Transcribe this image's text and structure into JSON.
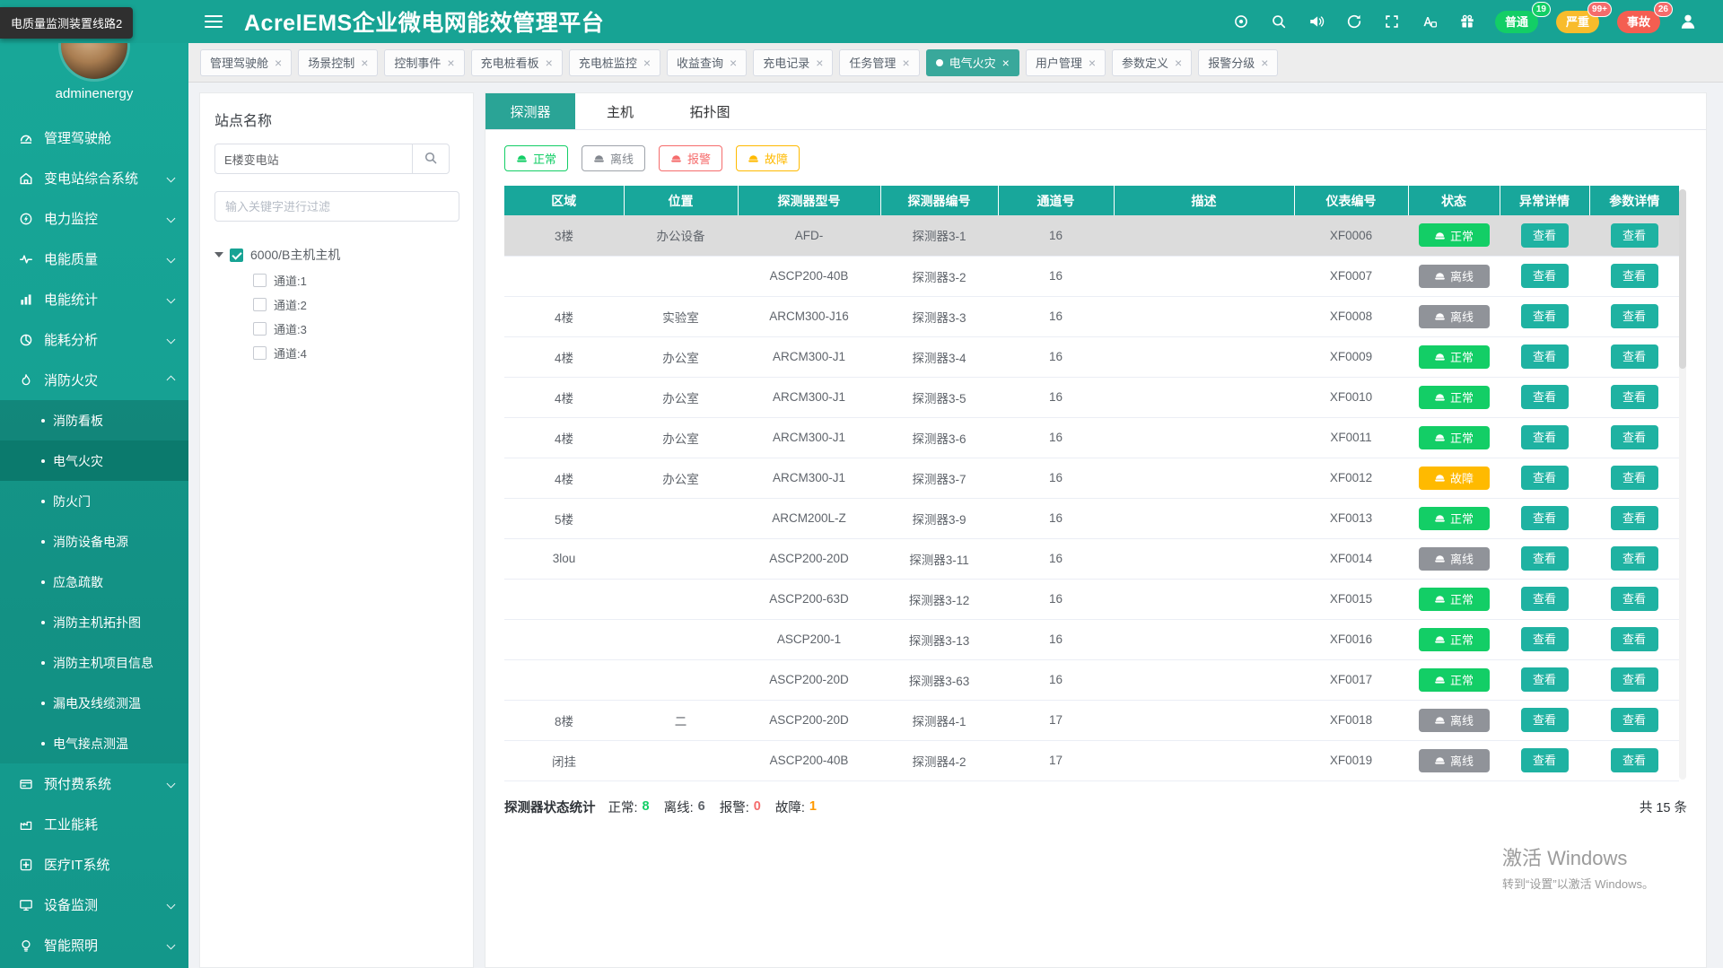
{
  "colors": {
    "primary": "#17a394",
    "green": "#13ce66",
    "gray": "#909399",
    "red": "#f56c6c",
    "orange": "#ffba00",
    "tab_active": "#39a89b"
  },
  "tooltip": {
    "text": "电质量监测装置线路2"
  },
  "header": {
    "title": "AcrelEMS企业微电网能效管理平台",
    "icons": [
      "target",
      "search",
      "speaker",
      "refresh",
      "fullscreen",
      "translate",
      "gift"
    ],
    "pills": [
      {
        "key": "normal",
        "label": "普通",
        "count": "19",
        "color": "#13ce66",
        "badge_color": "#13ce66"
      },
      {
        "key": "severe",
        "label": "严重",
        "count": "99+",
        "color": "#f8bc2c",
        "badge_color": "#f56c6c"
      },
      {
        "key": "accident",
        "label": "事故",
        "count": "26",
        "color": "#f45e51",
        "badge_color": "#f56c6c"
      }
    ]
  },
  "sidebar": {
    "username": "adminenergy",
    "items": [
      {
        "label": "管理驾驶舱",
        "icon": "dashboard",
        "expandable": false
      },
      {
        "label": "变电站综合系统",
        "icon": "station",
        "expandable": true
      },
      {
        "label": "电力监控",
        "icon": "power",
        "expandable": true
      },
      {
        "label": "电能质量",
        "icon": "quality",
        "expandable": true
      },
      {
        "label": "电能统计",
        "icon": "stats",
        "expandable": true
      },
      {
        "label": "能耗分析",
        "icon": "analysis",
        "expandable": true
      },
      {
        "label": "消防火灾",
        "icon": "fire",
        "expandable": true,
        "expanded": true,
        "children": [
          {
            "label": "消防看板",
            "highlighted": true
          },
          {
            "label": "电气火灾",
            "active": true
          },
          {
            "label": "防火门"
          },
          {
            "label": "消防设备电源"
          },
          {
            "label": "应急疏散"
          },
          {
            "label": "消防主机拓扑图"
          },
          {
            "label": "消防主机项目信息"
          },
          {
            "label": "漏电及线缆测温"
          },
          {
            "label": "电气接点测温"
          }
        ]
      },
      {
        "label": "预付费系统",
        "icon": "prepay",
        "expandable": true
      },
      {
        "label": "工业能耗",
        "icon": "industry",
        "expandable": false
      },
      {
        "label": "医疗IT系统",
        "icon": "medical",
        "expandable": false
      },
      {
        "label": "设备监测",
        "icon": "device",
        "expandable": true
      },
      {
        "label": "智能照明",
        "icon": "light",
        "expandable": true
      }
    ]
  },
  "tabbar": {
    "tabs": [
      {
        "label": "管理驾驶舱"
      },
      {
        "label": "场景控制"
      },
      {
        "label": "控制事件"
      },
      {
        "label": "充电桩看板"
      },
      {
        "label": "充电桩监控"
      },
      {
        "label": "收益查询"
      },
      {
        "label": "充电记录"
      },
      {
        "label": "任务管理"
      },
      {
        "label": "电气火灾",
        "active": true
      },
      {
        "label": "用户管理"
      },
      {
        "label": "参数定义"
      },
      {
        "label": "报警分级"
      }
    ]
  },
  "site_panel": {
    "title": "站点名称",
    "search_value": "E楼变电站",
    "filter_placeholder": "输入关键字进行过滤",
    "tree": {
      "root": {
        "label": "6000/B主机主机",
        "checked": true
      },
      "children": [
        {
          "label": "通道:1"
        },
        {
          "label": "通道:2"
        },
        {
          "label": "通道:3"
        },
        {
          "label": "通道:4"
        }
      ]
    }
  },
  "main": {
    "tabs": [
      {
        "label": "探测器",
        "active": true
      },
      {
        "label": "主机"
      },
      {
        "label": "拓扑图"
      }
    ],
    "filters": [
      {
        "label": "正常",
        "type": "normal"
      },
      {
        "label": "离线",
        "type": "offline"
      },
      {
        "label": "报警",
        "type": "alarm"
      },
      {
        "label": "故障",
        "type": "fault"
      }
    ],
    "table": {
      "headers": [
        "区域",
        "位置",
        "探测器型号",
        "探测器编号",
        "通道号",
        "描述",
        "仪表编号",
        "状态",
        "异常详情",
        "参数详情"
      ],
      "view_label": "查看",
      "status_labels": {
        "normal": "正常",
        "offline": "离线",
        "alarm": "报警",
        "fault": "故障"
      },
      "rows": [
        {
          "area": "3楼",
          "location": "办公设备",
          "model": "AFD-",
          "detector": "探测器3-1",
          "channel": "16",
          "desc": "",
          "meter": "XF0006",
          "status": "normal",
          "selected": true
        },
        {
          "area": "",
          "location": "",
          "model": "ASCP200-40B",
          "detector": "探测器3-2",
          "channel": "16",
          "desc": "",
          "meter": "XF0007",
          "status": "offline"
        },
        {
          "area": "4楼",
          "location": "实验室",
          "model": "ARCM300-J16",
          "detector": "探测器3-3",
          "channel": "16",
          "desc": "",
          "meter": "XF0008",
          "status": "offline"
        },
        {
          "area": "4楼",
          "location": "办公室",
          "model": "ARCM300-J1",
          "detector": "探测器3-4",
          "channel": "16",
          "desc": "",
          "meter": "XF0009",
          "status": "normal"
        },
        {
          "area": "4楼",
          "location": "办公室",
          "model": "ARCM300-J1",
          "detector": "探测器3-5",
          "channel": "16",
          "desc": "",
          "meter": "XF0010",
          "status": "normal"
        },
        {
          "area": "4楼",
          "location": "办公室",
          "model": "ARCM300-J1",
          "detector": "探测器3-6",
          "channel": "16",
          "desc": "",
          "meter": "XF0011",
          "status": "normal"
        },
        {
          "area": "4楼",
          "location": "办公室",
          "model": "ARCM300-J1",
          "detector": "探测器3-7",
          "channel": "16",
          "desc": "",
          "meter": "XF0012",
          "status": "fault"
        },
        {
          "area": "5楼",
          "location": "",
          "model": "ARCM200L-Z",
          "detector": "探测器3-9",
          "channel": "16",
          "desc": "",
          "meter": "XF0013",
          "status": "normal"
        },
        {
          "area": "3lou",
          "location": "",
          "model": "ASCP200-20D",
          "detector": "探测器3-11",
          "channel": "16",
          "desc": "",
          "meter": "XF0014",
          "status": "offline"
        },
        {
          "area": "",
          "location": "",
          "model": "ASCP200-63D",
          "detector": "探测器3-12",
          "channel": "16",
          "desc": "",
          "meter": "XF0015",
          "status": "normal"
        },
        {
          "area": "",
          "location": "",
          "model": "ASCP200-1",
          "detector": "探测器3-13",
          "channel": "16",
          "desc": "",
          "meter": "XF0016",
          "status": "normal"
        },
        {
          "area": "",
          "location": "",
          "model": "ASCP200-20D",
          "detector": "探测器3-63",
          "channel": "16",
          "desc": "",
          "meter": "XF0017",
          "status": "normal"
        },
        {
          "area": "8楼",
          "location": "二",
          "model": "ASCP200-20D",
          "detector": "探测器4-1",
          "channel": "17",
          "desc": "",
          "meter": "XF0018",
          "status": "offline"
        },
        {
          "area": "闭挂",
          "location": "",
          "model": "ASCP200-40B",
          "detector": "探测器4-2",
          "channel": "17",
          "desc": "",
          "meter": "XF0019",
          "status": "offline"
        }
      ]
    },
    "stats": {
      "label": "探测器状态统计",
      "normal_label": "正常:",
      "normal": "8",
      "offline_label": "离线:",
      "offline": "6",
      "alarm_label": "报警:",
      "alarm": "0",
      "fault_label": "故障:",
      "fault": "1",
      "total": "共 15 条"
    }
  },
  "watermark": {
    "line1": "激活 Windows",
    "line2": "转到“设置”以激活 Windows。"
  }
}
